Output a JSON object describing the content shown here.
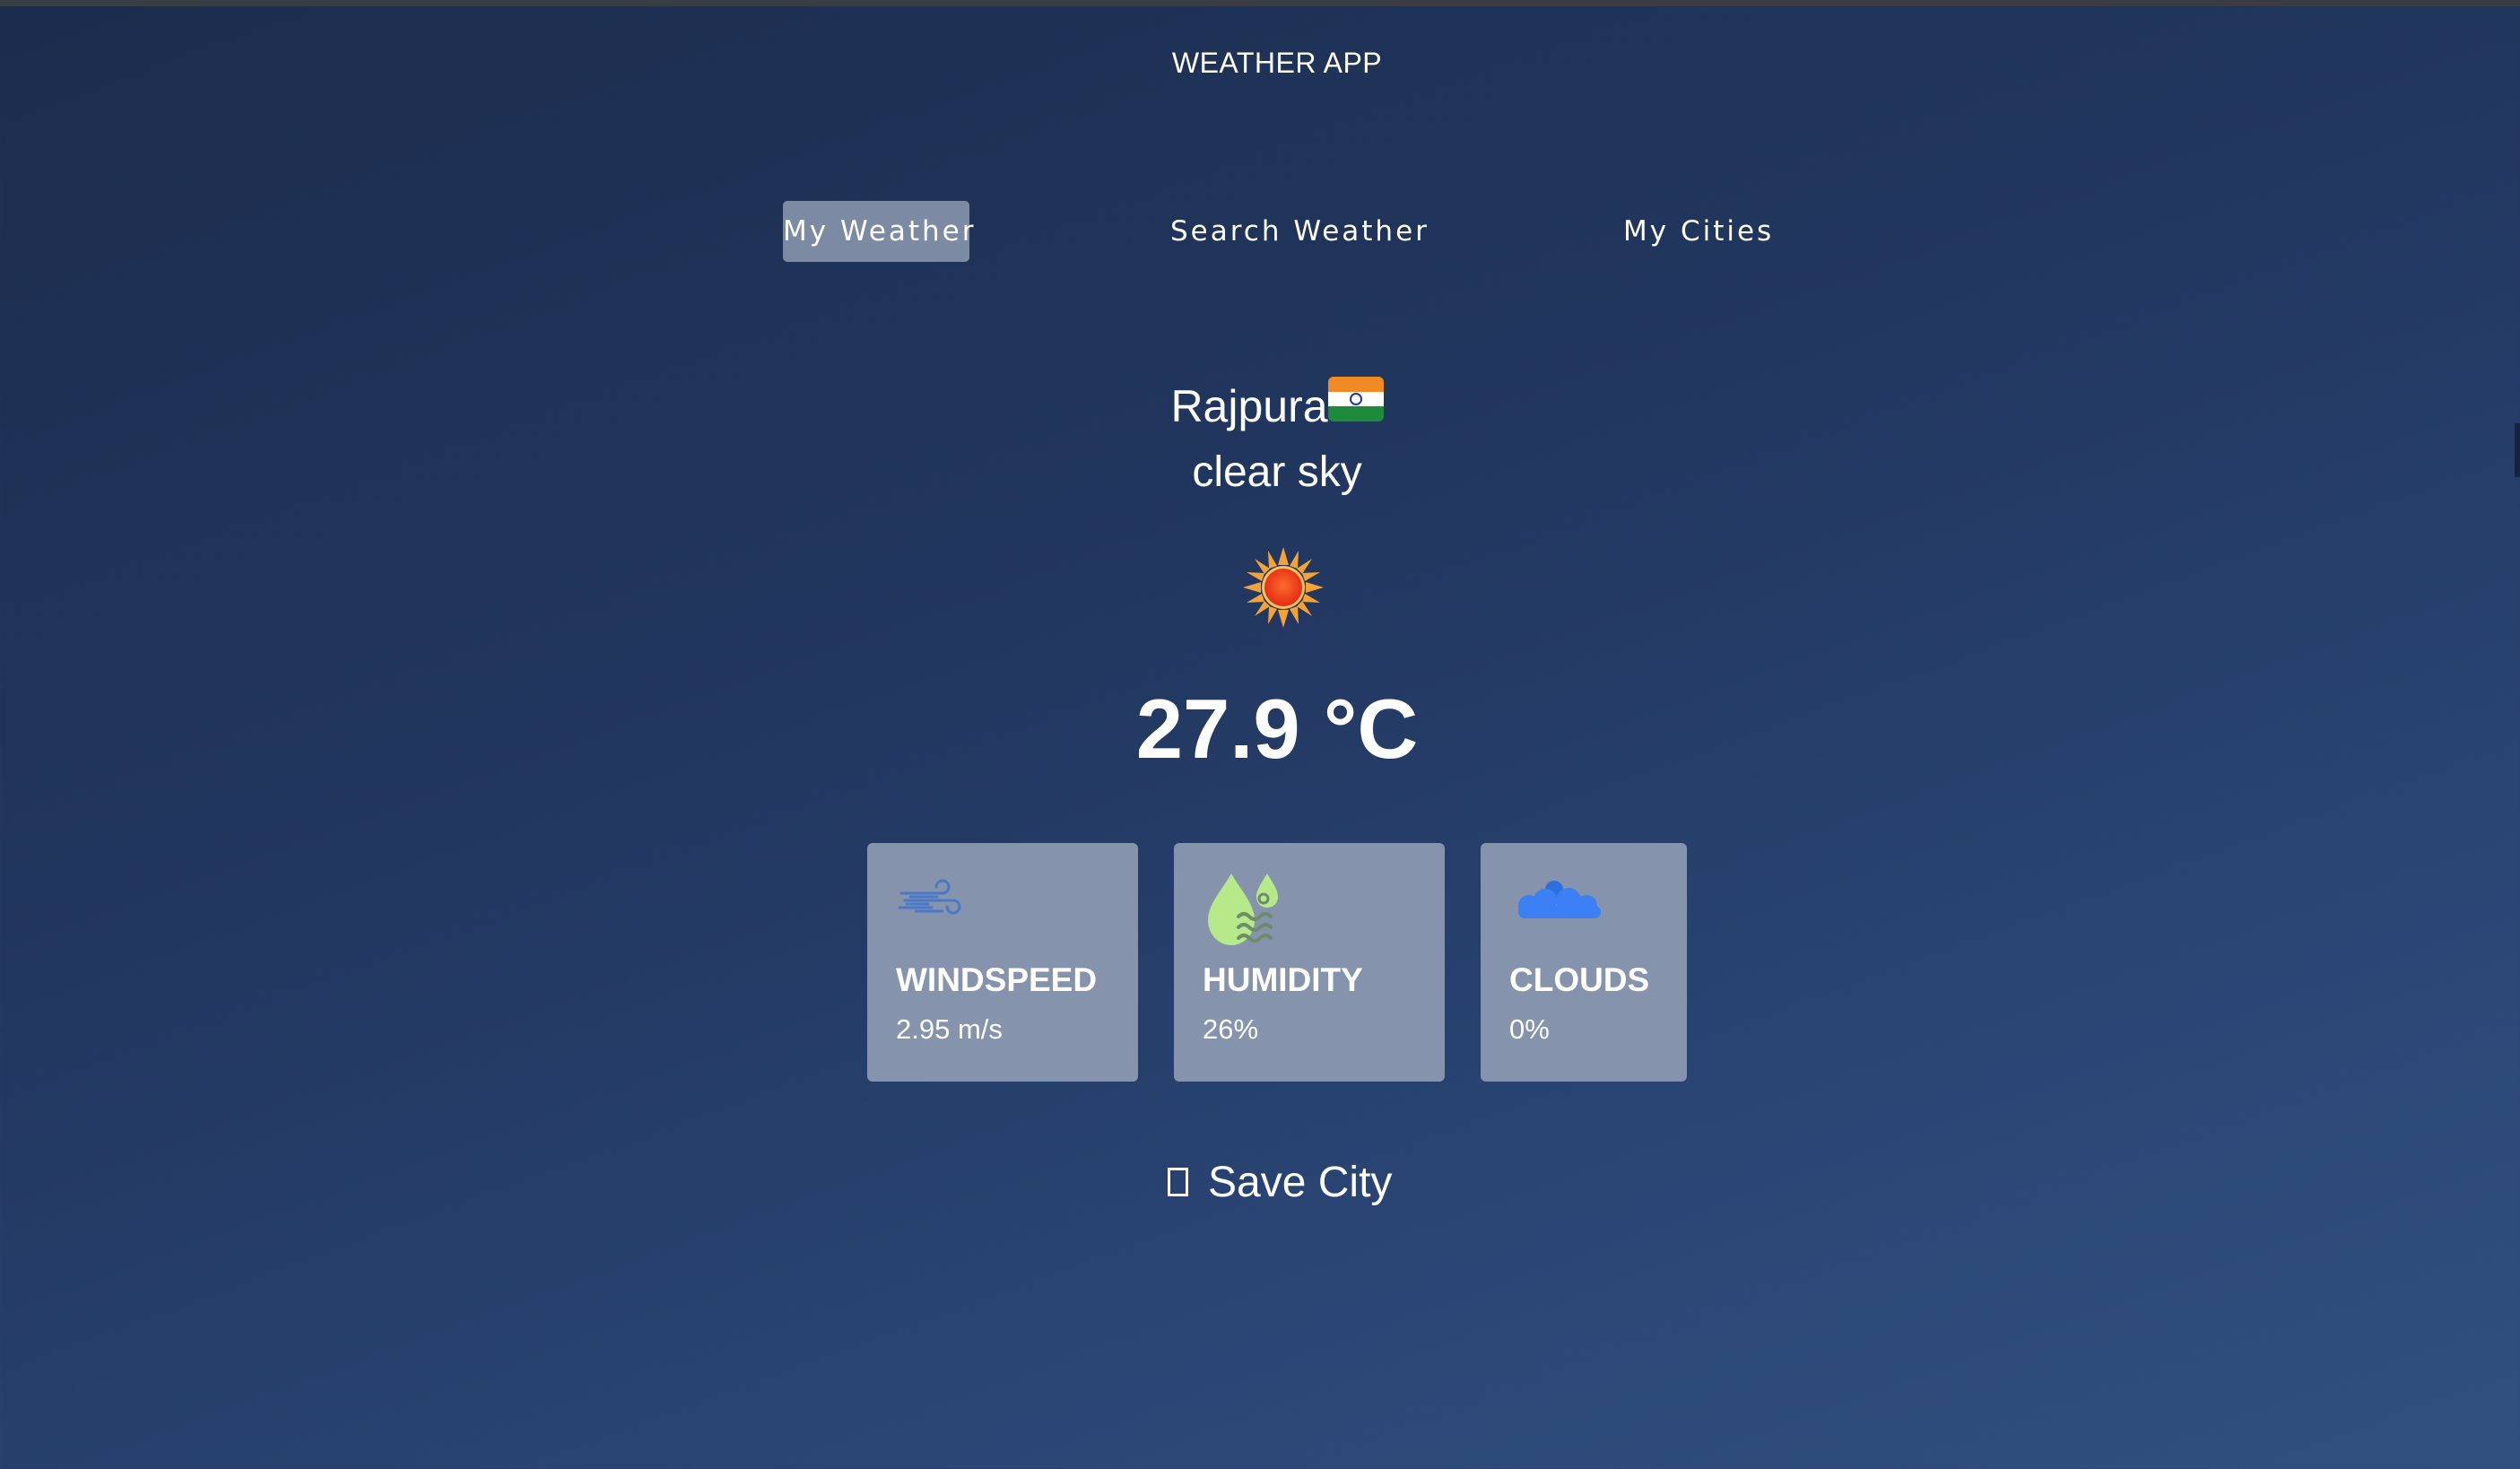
{
  "app": {
    "title": "WEATHER APP"
  },
  "nav": {
    "tabs": [
      {
        "label": "My Weather",
        "active": true
      },
      {
        "label": "Search Weather",
        "active": false
      },
      {
        "label": "My Cities",
        "active": false
      }
    ]
  },
  "weather": {
    "city": "Rajpura",
    "country_flag": "india-flag-icon",
    "description": "clear sky",
    "condition_icon": "sun-icon",
    "temperature": "27.9 °C"
  },
  "stats": {
    "windspeed": {
      "label": "WINDSPEED",
      "value": "2.95 m/s",
      "icon": "wind-icon"
    },
    "humidity": {
      "label": "HUMIDITY",
      "value": "26%",
      "icon": "humidity-drop-icon"
    },
    "clouds": {
      "label": "CLOUDS",
      "value": "0%",
      "icon": "cloud-icon"
    }
  },
  "save": {
    "label": "Save City",
    "checked": false
  },
  "colors": {
    "background_top": "#1c2c4d",
    "background_bottom": "#31507f",
    "card_background": "#8693ac",
    "active_tab": "#7d8aa4",
    "wind_icon": "#4a78c8",
    "humidity_icon": "#b5e98a",
    "cloud_icon": "#3c7ff5",
    "sun_core": "#ee3b1d",
    "sun_rays": "#f4a23a"
  }
}
